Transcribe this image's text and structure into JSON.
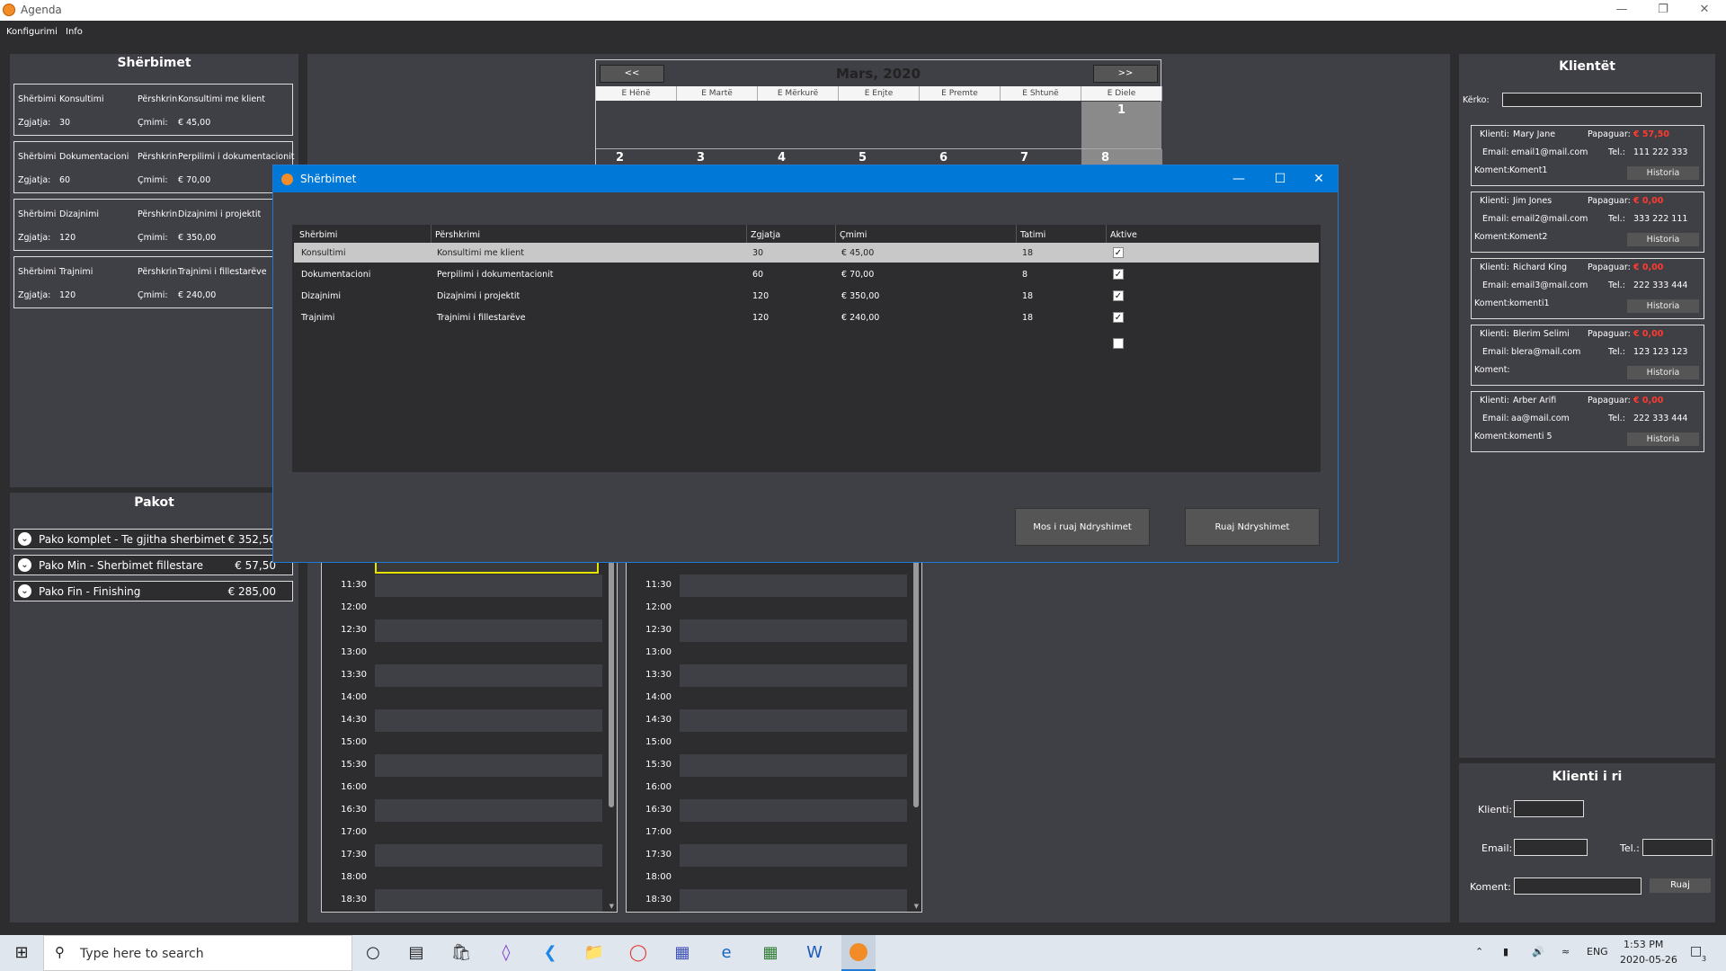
{
  "app": {
    "title": "Agenda"
  },
  "menu": {
    "items": [
      "Konfigurimi",
      "Info"
    ]
  },
  "services_panel": {
    "title": "Shërbimet",
    "label_service": "Shërbimi",
    "label_desc": "Përshkrin",
    "label_duration": "Zgjatja:",
    "label_price": "Çmimi:",
    "items": [
      {
        "name": "Konsultimi",
        "desc": "Konsultimi me klient",
        "duration": "30",
        "price": "€ 45,00"
      },
      {
        "name": "Dokumentacioni",
        "desc": "Perpilimi i dokumentacionit",
        "duration": "60",
        "price": "€ 70,00"
      },
      {
        "name": "Dizajnimi",
        "desc": "Dizajnimi i projektit",
        "duration": "120",
        "price": "€ 350,00"
      },
      {
        "name": "Trajnimi",
        "desc": "Trajnimi i fillestarëve",
        "duration": "120",
        "price": "€ 240,00"
      }
    ]
  },
  "packages_panel": {
    "title": "Pakot",
    "items": [
      {
        "name": "Pako komplet - Te gjitha sherbimet",
        "price": "€ 352,50"
      },
      {
        "name": "Pako Min - Sherbimet fillestare",
        "price": "€ 57,50"
      },
      {
        "name": "Pako Fin - Finishing",
        "price": "€ 285,00"
      }
    ]
  },
  "calendar": {
    "month": "Mars, 2020",
    "prev": "<<",
    "next": ">>",
    "days": [
      "E Hënë",
      "E Martë",
      "E Mërkurë",
      "E Enjte",
      "E Premte",
      "E Shtunë",
      "E Diele"
    ],
    "week1": [
      "1"
    ],
    "week2": [
      "2",
      "3",
      "4",
      "5",
      "6",
      "7",
      "8"
    ]
  },
  "schedule": {
    "times": [
      "11:30",
      "12:00",
      "12:30",
      "13:00",
      "13:30",
      "14:00",
      "14:30",
      "15:00",
      "15:30",
      "16:00",
      "16:30",
      "17:00",
      "17:30",
      "18:00",
      "18:30"
    ]
  },
  "clients_panel": {
    "title": "Klientët",
    "search_label": "Kërko:",
    "search_value": "",
    "label_client": "Klienti:",
    "label_paid": "Papaguar:",
    "label_email": "Email:",
    "label_tel": "Tel.:",
    "label_comment": "Koment:",
    "history_label": "Historia",
    "items": [
      {
        "name": "Mary Jane",
        "unpaid": "€ 57,50",
        "email": "email1@mail.com",
        "tel": "111 222 333",
        "comment": "Koment1"
      },
      {
        "name": "Jim Jones",
        "unpaid": "€ 0,00",
        "email": "email2@mail.com",
        "tel": "333 222 111",
        "comment": "Koment2"
      },
      {
        "name": "Richard King",
        "unpaid": "€ 0,00",
        "email": "email3@mail.com",
        "tel": "222 333 444",
        "comment": "komenti1"
      },
      {
        "name": "Blerim Selimi",
        "unpaid": "€ 0,00",
        "email": "blera@mail.com",
        "tel": "123 123 123",
        "comment": ""
      },
      {
        "name": "Arber Arifi",
        "unpaid": "€ 0,00",
        "email": "aa@mail.com",
        "tel": "222 333 444",
        "comment": "komenti 5"
      }
    ]
  },
  "new_client": {
    "title": "Klienti i ri",
    "label_client": "Klienti:",
    "label_email": "Email:",
    "label_tel": "Tel.:",
    "label_comment": "Koment:",
    "save": "Ruaj",
    "client_value": "",
    "email_value": "",
    "tel_value": "",
    "comment_value": ""
  },
  "dialog": {
    "title": "Shërbimet",
    "columns": [
      "Shërbimi",
      "Përshkrimi",
      "Zgjatja",
      "Çmimi",
      "Tatimi",
      "Aktive"
    ],
    "rows": [
      {
        "service": "Konsultimi",
        "desc": "Konsultimi me klient",
        "duration": "30",
        "price": "€ 45,00",
        "tax": "18",
        "active": true
      },
      {
        "service": "Dokumentacioni",
        "desc": "Perpilimi i dokumentacionit",
        "duration": "60",
        "price": "€ 70,00",
        "tax": "8",
        "active": true
      },
      {
        "service": "Dizajnimi",
        "desc": "Dizajnimi i projektit",
        "duration": "120",
        "price": "€ 350,00",
        "tax": "18",
        "active": true
      },
      {
        "service": "Trajnimi",
        "desc": "Trajnimi i fillestarëve",
        "duration": "120",
        "price": "€ 240,00",
        "tax": "18",
        "active": true
      }
    ],
    "new_row_active": false,
    "discard": "Mos i ruaj Ndryshimet",
    "save": "Ruaj Ndryshimet"
  },
  "taskbar": {
    "search_placeholder": "Type here to search",
    "time": "1:53 PM",
    "date": "2020-05-26",
    "lang": "ENG",
    "notifications": "3"
  },
  "colors": {
    "accent": "#0078d7",
    "unpaid_red": "#ff3b30",
    "selected_row": "#c8c8c8",
    "highlight": "#e5e500"
  }
}
